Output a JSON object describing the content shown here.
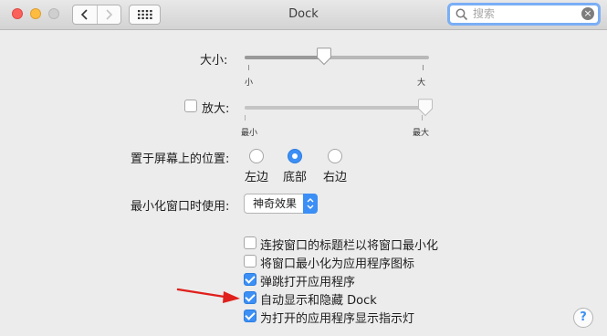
{
  "window": {
    "title": "Dock"
  },
  "toolbar": {
    "back_icon": "chevron-left-icon",
    "forward_icon": "chevron-right-icon",
    "grid_icon": "grid-icon",
    "search": {
      "placeholder": "搜索",
      "value": ""
    }
  },
  "size": {
    "label": "大小:",
    "min_label": "小",
    "max_label": "大",
    "level": 0.43
  },
  "magnification": {
    "label": "放大:",
    "checked": false,
    "min_label": "最小",
    "max_label": "最大",
    "level": 1.0
  },
  "position": {
    "label": "置于屏幕上的位置:",
    "options": [
      {
        "label": "左边",
        "selected": false
      },
      {
        "label": "底部",
        "selected": true
      },
      {
        "label": "右边",
        "selected": false
      }
    ]
  },
  "minimize": {
    "label": "最小化窗口时使用:",
    "selected": "神奇效果"
  },
  "options": [
    {
      "label": "连按窗口的标题栏以将窗口最小化",
      "checked": false
    },
    {
      "label": "将窗口最小化为应用程序图标",
      "checked": false
    },
    {
      "label": "弹跳打开应用程序",
      "checked": true
    },
    {
      "label": "自动显示和隐藏 Dock",
      "checked": true
    },
    {
      "label": "为打开的应用程序显示指示灯",
      "checked": true
    }
  ],
  "help": {
    "label": "?"
  },
  "colors": {
    "accent": "#3b8ff5",
    "annotation_arrow": "#e0201c"
  }
}
